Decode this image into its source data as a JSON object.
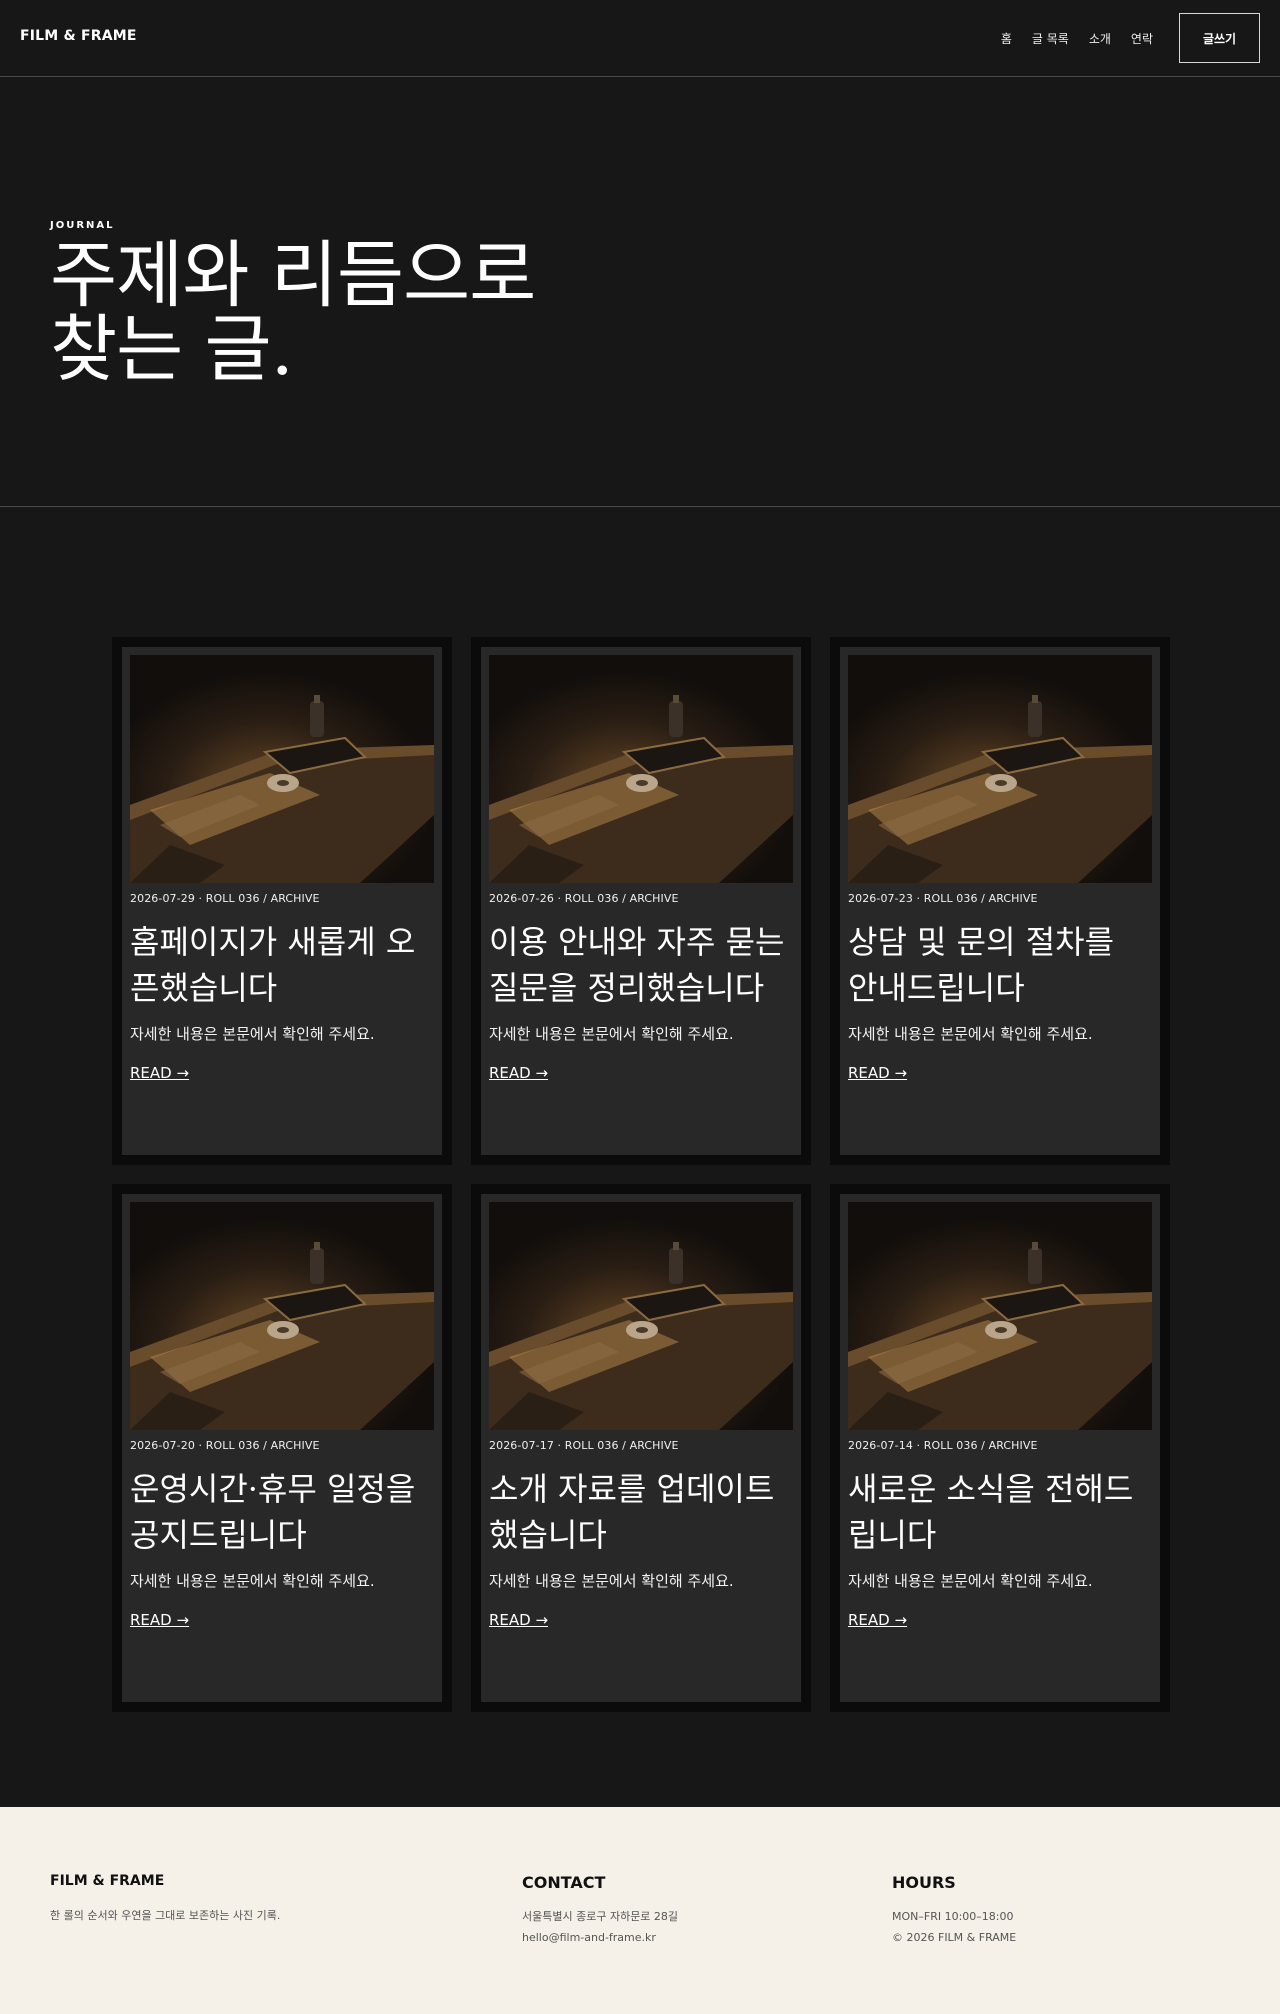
{
  "header": {
    "brand": "FILM & FRAME",
    "nav": [
      "홈",
      "글 목록",
      "소개",
      "연락"
    ],
    "write_label": "글쓰기"
  },
  "hero": {
    "eyebrow": "JOURNAL",
    "title_line1": "주제와 리듬으로",
    "title_line2": "찾는 글."
  },
  "posts": [
    {
      "meta": "2026-07-29 · ROLL 036 / ARCHIVE",
      "title": "홈페이지가 새롭게 오픈했습니다",
      "excerpt": "자세한 내용은 본문에서 확인해 주세요.",
      "read": "READ →"
    },
    {
      "meta": "2026-07-26 · ROLL 036 / ARCHIVE",
      "title": "이용 안내와 자주 묻는 질문을 정리했습니다",
      "excerpt": "자세한 내용은 본문에서 확인해 주세요.",
      "read": "READ →"
    },
    {
      "meta": "2026-07-23 · ROLL 036 / ARCHIVE",
      "title": "상담 및 문의 절차를 안내드립니다",
      "excerpt": "자세한 내용은 본문에서 확인해 주세요.",
      "read": "READ →"
    },
    {
      "meta": "2026-07-20 · ROLL 036 / ARCHIVE",
      "title": "운영시간·휴무 일정을 공지드립니다",
      "excerpt": "자세한 내용은 본문에서 확인해 주세요.",
      "read": "READ →"
    },
    {
      "meta": "2026-07-17 · ROLL 036 / ARCHIVE",
      "title": "소개 자료를 업데이트했습니다",
      "excerpt": "자세한 내용은 본문에서 확인해 주세요.",
      "read": "READ →"
    },
    {
      "meta": "2026-07-14 · ROLL 036 / ARCHIVE",
      "title": "새로운 소식을 전해드립니다",
      "excerpt": "자세한 내용은 본문에서 확인해 주세요.",
      "read": "READ →"
    }
  ],
  "footer": {
    "brand": "FILM & FRAME",
    "tagline": "한 롤의 순서와 우연을 그대로 보존하는 사진 기록.",
    "contact_heading": "CONTACT",
    "address": "서울특별시 종로구 자하문로 28길",
    "email": "hello@film-and-frame.kr",
    "hours_heading": "HOURS",
    "hours": "MON–FRI 10:00–18:00",
    "copyright": "© 2026 FILM & FRAME"
  }
}
